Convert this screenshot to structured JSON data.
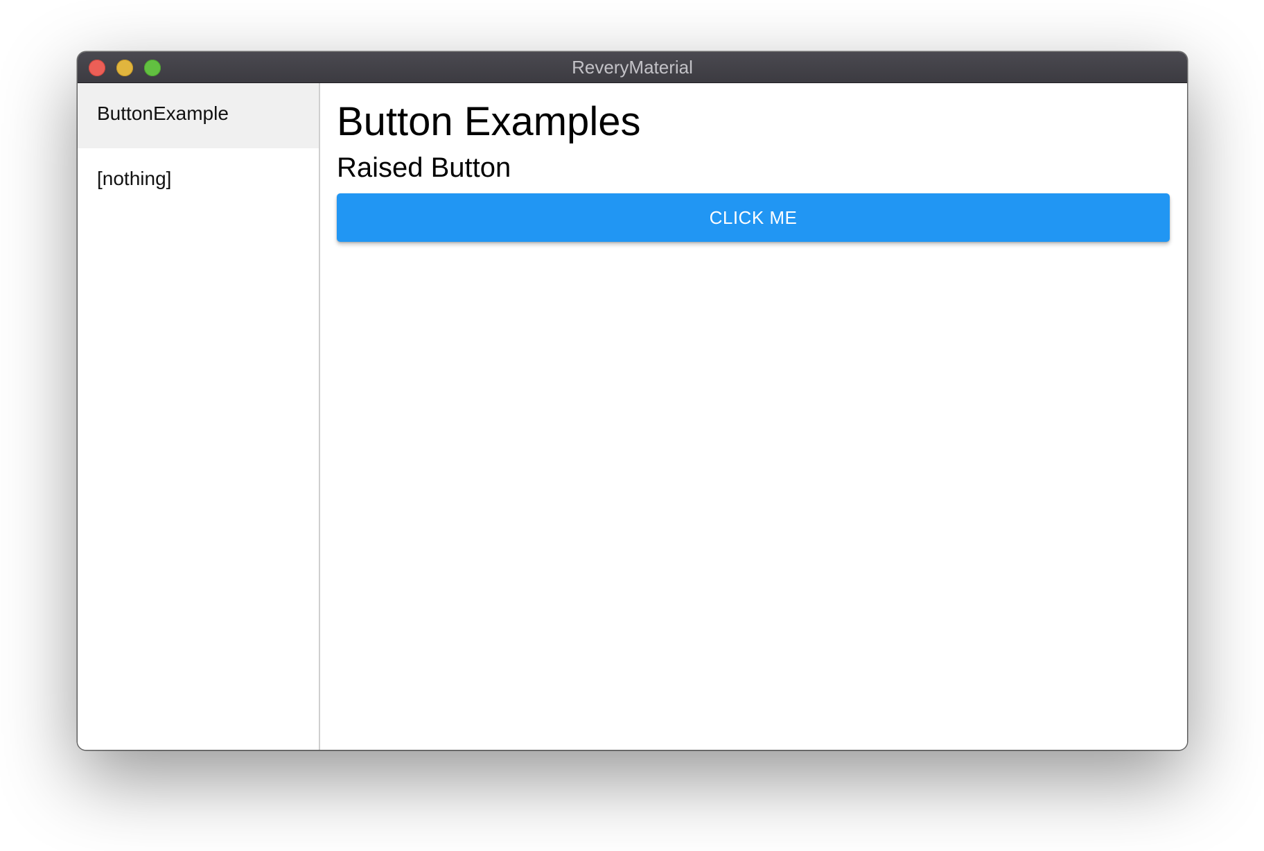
{
  "window": {
    "title": "ReveryMaterial"
  },
  "sidebar": {
    "items": [
      {
        "label": "ButtonExample",
        "selected": true
      },
      {
        "label": "[nothing]",
        "selected": false
      }
    ]
  },
  "main": {
    "title": "Button Examples",
    "section_title": "Raised Button",
    "button_label": "CLICK ME"
  },
  "colors": {
    "accent": "#2196f3",
    "titlebar": "#3f3e44",
    "selected_item": "#f0f0f0",
    "close": "#ec5f57",
    "minimize": "#e1b53e",
    "maximize": "#62c041"
  }
}
